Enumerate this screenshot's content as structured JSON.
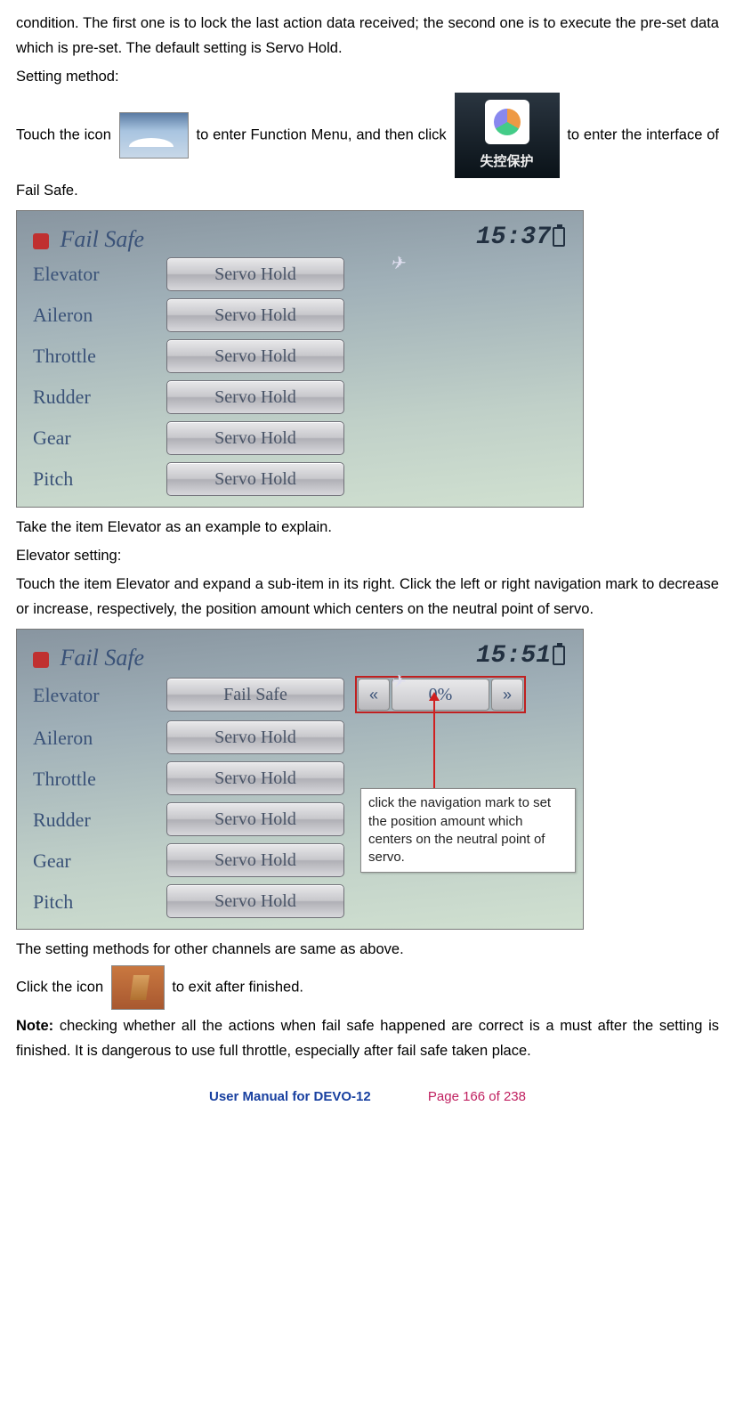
{
  "para1": "condition. The first one is to lock the last action data received; the second one is to execute the pre-set data which is pre-set. The default setting is Servo Hold.",
  "para2": "Setting method:",
  "para3a": "Touch the icon",
  "para3b": "to enter Function Menu, and then click",
  "para3c": "to enter the interface of Fail Safe.",
  "failIconText": "失控保护",
  "shot1": {
    "title": "Fail Safe",
    "time": "15:37",
    "rows": [
      {
        "label": "Elevator",
        "value": "Servo Hold"
      },
      {
        "label": "Aileron",
        "value": "Servo Hold"
      },
      {
        "label": "Throttle",
        "value": "Servo Hold"
      },
      {
        "label": "Rudder",
        "value": "Servo Hold"
      },
      {
        "label": "Gear",
        "value": "Servo Hold"
      },
      {
        "label": "Pitch",
        "value": "Servo Hold"
      }
    ]
  },
  "para4": "Take the item Elevator as an example to explain.",
  "para5": "Elevator setting:",
  "para6": "Touch the item Elevator and expand a sub-item in its right. Click the left or right navigation mark to decrease or increase, respectively, the position amount which centers on the neutral point of servo.",
  "shot2": {
    "title": "Fail Safe",
    "time": "15:51",
    "rows": [
      {
        "label": "Elevator",
        "value": "Fail Safe"
      },
      {
        "label": "Aileron",
        "value": "Servo Hold"
      },
      {
        "label": "Throttle",
        "value": "Servo Hold"
      },
      {
        "label": "Rudder",
        "value": "Servo Hold"
      },
      {
        "label": "Gear",
        "value": "Servo Hold"
      },
      {
        "label": "Pitch",
        "value": "Servo Hold"
      }
    ],
    "spinnerLeft": "«",
    "spinnerValue": "0%",
    "spinnerRight": "»",
    "callout": "click the navigation mark to set the position amount which centers on the neutral point of servo."
  },
  "para7": "The setting methods for other channels are same as above.",
  "para8a": "Click the icon",
  "para8b": "to exit after finished.",
  "noteLabel": "Note:",
  "para9": " checking whether all the actions when fail safe happened are correct is a must after the setting is finished. It is dangerous to use full throttle, especially after fail safe taken place.",
  "footerLeft": "User Manual for DEVO-12",
  "footerRight": "Page 166 of 238"
}
